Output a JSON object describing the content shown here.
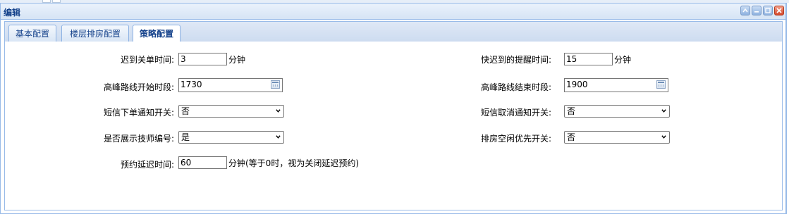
{
  "window": {
    "title": "编辑"
  },
  "tabs": [
    {
      "label": "基本配置"
    },
    {
      "label": "楼层排房配置"
    },
    {
      "label": "策略配置",
      "active": true
    }
  ],
  "form": {
    "late_close": {
      "label": "迟到关单时间:",
      "value": "3",
      "unit": "分钟"
    },
    "late_remind": {
      "label": "快迟到的提醒时间:",
      "value": "15",
      "unit": "分钟"
    },
    "peak_start": {
      "label": "高峰路线开始时段:",
      "value": "1730"
    },
    "peak_end": {
      "label": "高峰路线结束时段:",
      "value": "1900"
    },
    "sms_order": {
      "label": "短信下单通知开关:",
      "value": "否"
    },
    "sms_cancel": {
      "label": "短信取消通知开关:",
      "value": "否"
    },
    "show_tech_no": {
      "label": "是否展示技师编号:",
      "value": "是"
    },
    "room_idle_first": {
      "label": "排房空闲优先开关:",
      "value": "否"
    },
    "booking_delay": {
      "label": "预约延迟时间:",
      "value": "60",
      "unit": "分钟(等于0时，视为关闭延迟预约)"
    }
  },
  "icons": {
    "window_tools": [
      "collapse-icon",
      "minimize-icon",
      "maximize-icon",
      "close-icon"
    ],
    "date_picker": "calendar-icon",
    "select_arrow": "chevron-down-icon"
  }
}
